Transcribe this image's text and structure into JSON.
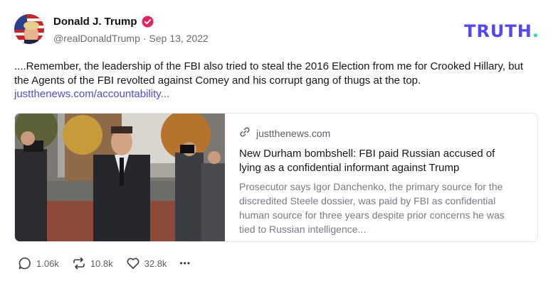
{
  "author": {
    "name": "Donald J. Trump",
    "handle": "@realDonaldTrump",
    "separator": "·",
    "date": "Sep 13, 2022",
    "verified_color": "#e0245e"
  },
  "brand": {
    "logo_text": "TRUTH",
    "logo_dot": ".",
    "logo_color": "#5448ee",
    "dot_color": "#25d4c5"
  },
  "post": {
    "text": "....Remember, the leadership of the FBI also tried to steal the 2016 Election from me for Crooked Hillary, but the Agents of the FBI revolted against Comey and his corrupt gang of thugs at the top.",
    "link": "justthenews.com/accountability..."
  },
  "card": {
    "domain": "justthenews.com",
    "title": "New Durham bombshell: FBI paid Russian accused of lying as a confidential informant against Trump",
    "description": "Prosecutor says Igor Danchenko, the primary source for the discredited Steele dossier, was paid by FBI as confidential human source for three years despite prior concerns he was tied to Russian intelligence..."
  },
  "actions": {
    "replies": "1.06k",
    "retruths": "10.8k",
    "likes": "32.8k",
    "more": "•••"
  },
  "icons": {
    "verified": "verified-badge-icon",
    "link": "link-chain-icon",
    "reply": "speech-bubble-icon",
    "retruth": "repost-arrows-icon",
    "like": "heart-icon",
    "more": "ellipsis-icon"
  },
  "colors": {
    "link": "#4a4fd6",
    "muted": "#6b6b76"
  }
}
